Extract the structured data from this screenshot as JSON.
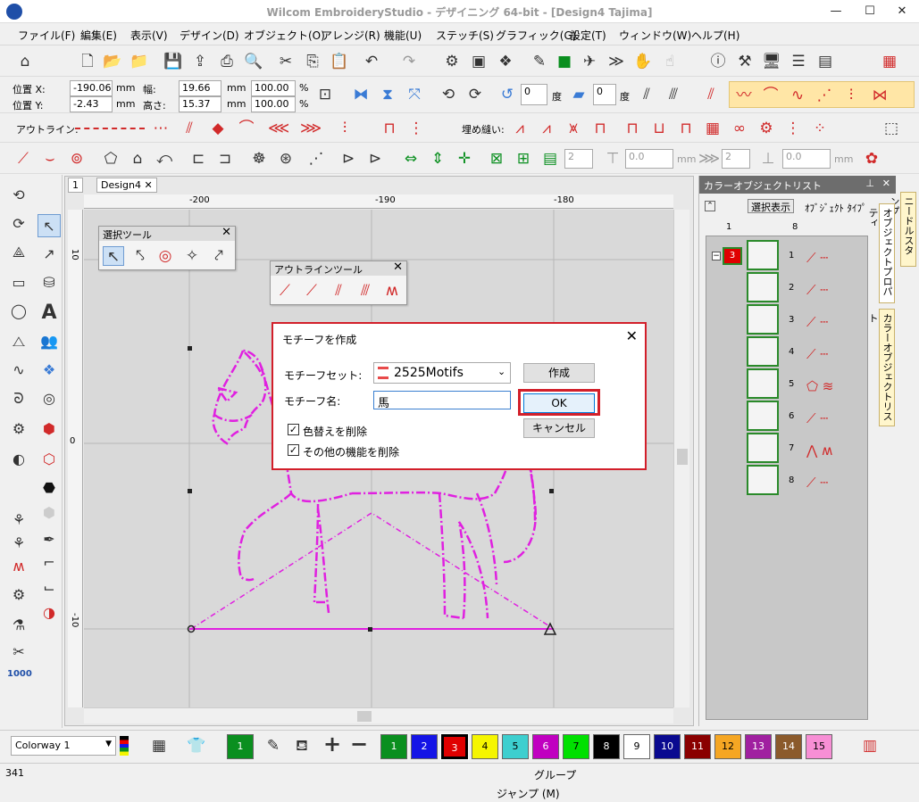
{
  "window": {
    "title": "Wilcom EmbroideryStudio - デザイニング 64-bit - [Design4     Tajima]"
  },
  "menu": [
    "ファイル(F)",
    "編集(E)",
    "表示(V)",
    "デザイン(D)",
    "オブジェクト(O)",
    "アレンジ(R)",
    "機能(U)",
    "ステッチ(S)",
    "グラフィック(G)",
    "設定(T)",
    "ウィンドウ(W)",
    "ヘルプ(H)"
  ],
  "position_bar": {
    "pos_x_label": "位置 X:",
    "pos_x_value": "-190.06",
    "pos_y_label": "位置 Y:",
    "pos_y_value": "-2.43",
    "unit": "mm",
    "width_label": "幅:",
    "width_value": "19.66",
    "height_label": "高さ:",
    "height_value": "15.37",
    "scale_w": "100.00",
    "scale_h": "100.00",
    "percent": "%",
    "rotate_value": "0",
    "rotate_unit": "度",
    "slant_value": "0",
    "slant_unit": "度"
  },
  "outline_bar": {
    "outline_label": "アウトライン:",
    "fill_label": "埋め縫い:"
  },
  "fourth_bar": {
    "v1": "2",
    "v2": "0.0",
    "unit": "mm",
    "v3": "2",
    "v4": "0.0"
  },
  "tabs": [
    "1",
    "Design4"
  ],
  "rulers": {
    "h": [
      "-200",
      "-190",
      "-180"
    ],
    "v": [
      "10",
      "0",
      "-10"
    ]
  },
  "select_panel": {
    "title": "選択ツール"
  },
  "outline_panel": {
    "title": "アウトラインツール"
  },
  "dialog": {
    "title": "モチーフを作成",
    "set_label": "モチーフセット:",
    "set_value": "2525Motifs",
    "name_label": "モチーフ名:",
    "name_value": "馬",
    "create_button": "作成",
    "ok_button": "OK",
    "cancel_button": "キャンセル",
    "check1_label": "色替えを削除",
    "check2_label": "その他の機能を削除"
  },
  "color_panel": {
    "title": "カラーオブジェクトリスト",
    "select_display": "選択表示",
    "object_type": "ｵﾌﾞｼﾞｪｸﾄ ﾀｲﾌﾟ",
    "col1": "1",
    "col8": "8",
    "group_num": "3",
    "rows": [
      "1",
      "2",
      "3",
      "4",
      "5",
      "6",
      "7",
      "8"
    ],
    "side_tabs": [
      "ニードルスタンプ",
      "オブジェクトプロパティ",
      "カラーオブジェクトリスト"
    ]
  },
  "colorway": {
    "value": "Colorway 1",
    "current_color": "1"
  },
  "swatches": [
    {
      "n": "1",
      "bg": "#0a8f1f",
      "fg": "#ffffff"
    },
    {
      "n": "2",
      "bg": "#1414e6",
      "fg": "#ffffff"
    },
    {
      "n": "3",
      "bg": "#e00000",
      "fg": "#ffffff"
    },
    {
      "n": "4",
      "bg": "#f5f500",
      "fg": "#000000"
    },
    {
      "n": "5",
      "bg": "#3dcfcf",
      "fg": "#000000"
    },
    {
      "n": "6",
      "bg": "#c000c0",
      "fg": "#ffffff"
    },
    {
      "n": "7",
      "bg": "#00e000",
      "fg": "#000000"
    },
    {
      "n": "8",
      "bg": "#000000",
      "fg": "#ffffff"
    },
    {
      "n": "9",
      "bg": "#ffffff",
      "fg": "#000000"
    },
    {
      "n": "10",
      "bg": "#0a0a90",
      "fg": "#ffffff"
    },
    {
      "n": "11",
      "bg": "#8a0000",
      "fg": "#ffffff"
    },
    {
      "n": "12",
      "bg": "#f5a623",
      "fg": "#000000"
    },
    {
      "n": "13",
      "bg": "#a020a0",
      "fg": "#ffffff"
    },
    {
      "n": "14",
      "bg": "#8b5a2b",
      "fg": "#ffffff"
    },
    {
      "n": "15",
      "bg": "#f78fd5",
      "fg": "#000000"
    }
  ],
  "status": {
    "count": "341",
    "mode": "グループ",
    "jump": "ジャンプ (M)"
  },
  "colors": {
    "accent_red": "#d21f2a",
    "motif_magenta": "#e020e0",
    "group_green": "#2a8a2a"
  }
}
